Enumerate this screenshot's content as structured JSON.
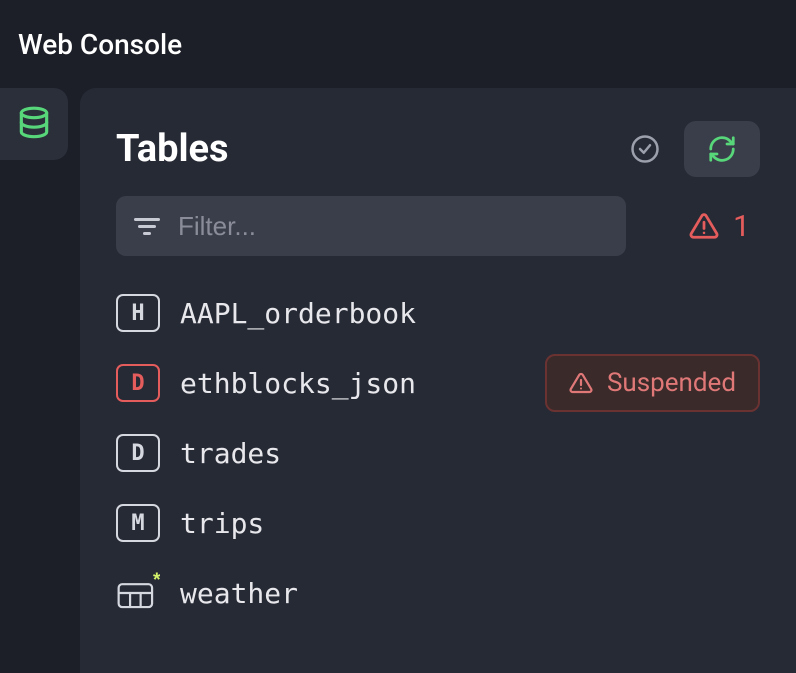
{
  "header": {
    "title": "Web Console"
  },
  "panel": {
    "title": "Tables",
    "filter_placeholder": "Filter...",
    "warning_count": "1"
  },
  "tables": [
    {
      "badge": "H",
      "badge_variant": "normal",
      "name": "AAPL_orderbook",
      "status": null
    },
    {
      "badge": "D",
      "badge_variant": "red",
      "name": "ethblocks_json",
      "status": "Suspended"
    },
    {
      "badge": "D",
      "badge_variant": "normal",
      "name": "trades",
      "status": null
    },
    {
      "badge": "M",
      "badge_variant": "normal",
      "name": "trips",
      "status": null
    },
    {
      "badge": "mat",
      "badge_variant": "svg",
      "name": "weather",
      "status": null
    }
  ]
}
